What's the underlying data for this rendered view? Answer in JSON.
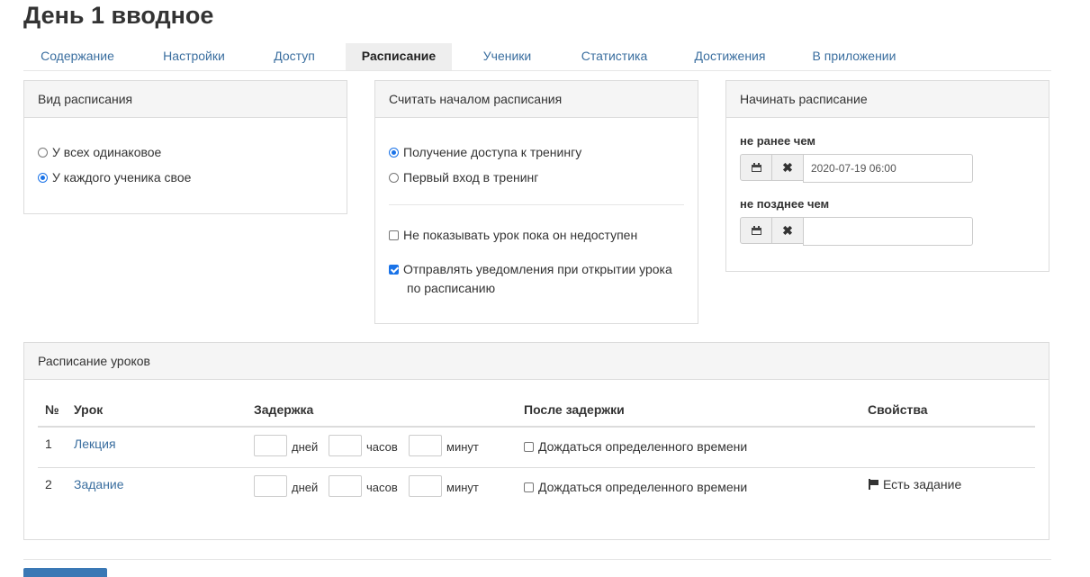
{
  "page": {
    "title": "День 1 вводное"
  },
  "tabs": [
    {
      "label": "Содержание",
      "active": false
    },
    {
      "label": "Настройки",
      "active": false
    },
    {
      "label": "Доступ",
      "active": false
    },
    {
      "label": "Расписание",
      "active": true
    },
    {
      "label": "Ученики",
      "active": false
    },
    {
      "label": "Статистика",
      "active": false
    },
    {
      "label": "Достижения",
      "active": false
    },
    {
      "label": "В приложении",
      "active": false
    }
  ],
  "schedule_type": {
    "title": "Вид расписания",
    "options": [
      {
        "label": "У всех одинаковое",
        "selected": false
      },
      {
        "label": "У каждого ученика свое",
        "selected": true
      }
    ]
  },
  "schedule_start": {
    "title": "Считать началом расписания",
    "options": [
      {
        "label": "Получение доступа к тренингу",
        "selected": true
      },
      {
        "label": "Первый вход в тренинг",
        "selected": false
      }
    ],
    "checkboxes": [
      {
        "label": "Не показывать урок пока он недоступен",
        "checked": false
      },
      {
        "label_line1": "Отправлять уведомления при открытии урока",
        "label_line2": "по расписанию",
        "checked": true
      }
    ]
  },
  "begin_schedule": {
    "title": "Начинать расписание",
    "not_earlier_label": "не ранее чем",
    "not_earlier_value": "2020-07-19 06:00",
    "not_later_label": "не позднее чем",
    "not_later_value": ""
  },
  "lessons": {
    "title": "Расписание уроков",
    "columns": {
      "num": "№",
      "lesson": "Урок",
      "delay": "Задержка",
      "after_delay": "После задержки",
      "properties": "Свойства"
    },
    "units": {
      "days": "дней",
      "hours": "часов",
      "minutes": "минут"
    },
    "wait_label": "Дождаться определенного времени",
    "rows": [
      {
        "num": "1",
        "name": "Лекция",
        "property": ""
      },
      {
        "num": "2",
        "name": "Задание",
        "property": "Есть задание"
      }
    ]
  },
  "icons": {
    "calendar": "calendar-icon",
    "clear": "times-icon",
    "flag": "flag-icon"
  },
  "colors": {
    "link": "#3a6e9f",
    "radio_checked": "#1a73e8",
    "primary_button": "#3a78b5",
    "panel_header_bg": "#f5f5f5"
  }
}
